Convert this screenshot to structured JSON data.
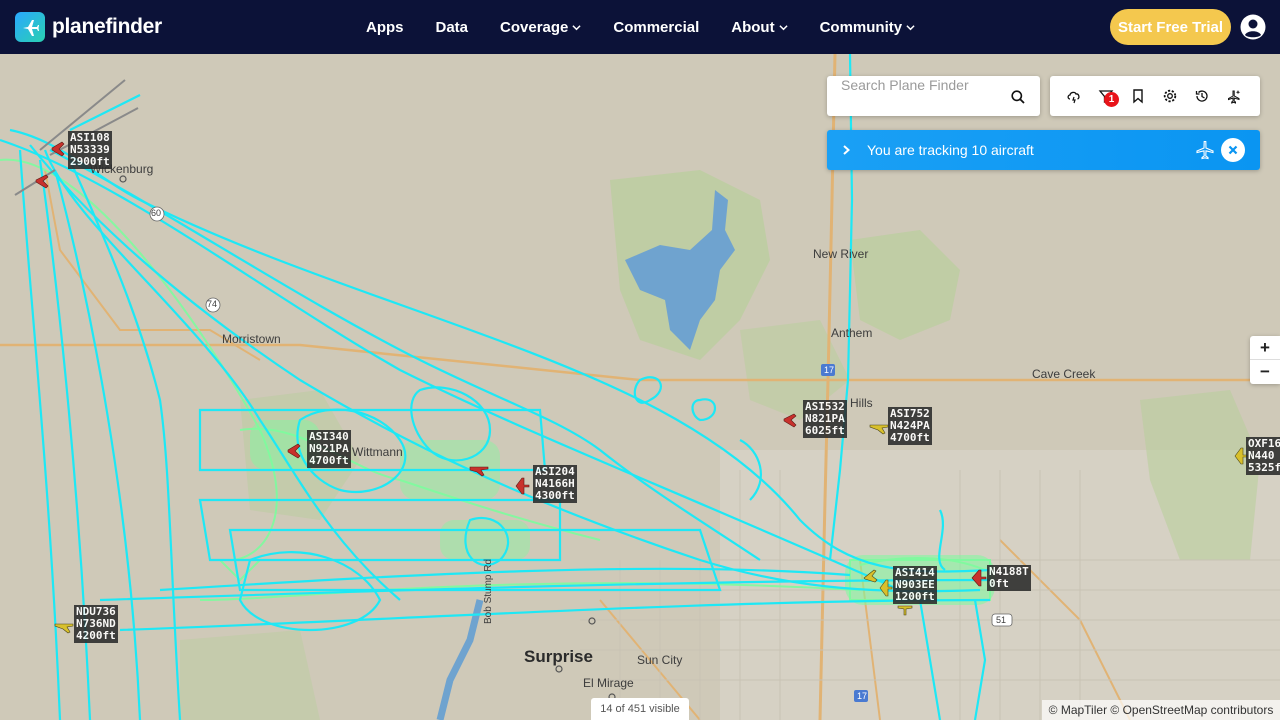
{
  "header": {
    "brand": "planefinder",
    "nav": [
      {
        "label": "Apps",
        "has_dropdown": false
      },
      {
        "label": "Data",
        "has_dropdown": false
      },
      {
        "label": "Coverage",
        "has_dropdown": true
      },
      {
        "label": "Commercial",
        "has_dropdown": false
      },
      {
        "label": "About",
        "has_dropdown": true
      },
      {
        "label": "Community",
        "has_dropdown": true
      }
    ],
    "cta": "Start Free Trial",
    "account_icon": "user-circle-icon"
  },
  "search": {
    "placeholder": "Search Plane Finder"
  },
  "toolbar": {
    "icons": [
      "weather-icon",
      "filter-icon",
      "bookmark-icon",
      "settings-icon",
      "history-icon",
      "flight-mode-icon"
    ],
    "filter_badge": "1"
  },
  "tracking": {
    "text": "You are tracking 10 aircraft"
  },
  "zoom": {
    "in": "+",
    "out": "−"
  },
  "map": {
    "places": {
      "wickenburg": "Wickenburg",
      "morristown": "Morristown",
      "wittmann": "Wittmann",
      "new_river": "New River",
      "anthem": "Anthem",
      "cave_creek": "Cave Creek",
      "hills": "Hills",
      "surprise": "Surprise",
      "sun_city": "Sun City",
      "el_mirage": "El Mirage",
      "bob_stump": "Bob Stump Rd",
      "hwy_17a": "17",
      "hwy_17b": "17",
      "hwy_51": "51",
      "hwy_74": "74",
      "hwy_60": "60"
    },
    "aircraft": [
      {
        "id": "ac-asi108",
        "line1": "ASI108",
        "line2": "N53339",
        "line3": "2900ft"
      },
      {
        "id": "ac-asi340",
        "line1": "ASI340",
        "line2": "N921PA",
        "line3": "4700ft"
      },
      {
        "id": "ac-asi204",
        "line1": "ASI204",
        "line2": "N4166H",
        "line3": "4300ft"
      },
      {
        "id": "ac-asi532",
        "line1": "ASI532",
        "line2": "N821PA",
        "line3": "6025ft"
      },
      {
        "id": "ac-asi752",
        "line1": "ASI752",
        "line2": "N424PA",
        "line3": "4700ft"
      },
      {
        "id": "ac-oxf",
        "line1": "OXF16",
        "line2": "N440",
        "line3": "5325f"
      },
      {
        "id": "ac-asi414",
        "line1": "ASI414",
        "line2": "N903EE",
        "line3": "1200ft"
      },
      {
        "id": "ac-n4188t",
        "line1": "N4188T",
        "line2": "0ft",
        "line3": ""
      },
      {
        "id": "ac-ndu736",
        "line1": "NDU736",
        "line2": "N736ND",
        "line3": "4200ft"
      }
    ],
    "colors": {
      "track_cyan": "#1ee8f5",
      "track_green": "#7dfc9e",
      "lake": "#6fa3cf",
      "park": "#b9ce9d",
      "plane_red": "#c8312c",
      "plane_yellow": "#d8c02c"
    }
  },
  "footer": {
    "visible_count": "14 of 451 visible",
    "attribution": "© MapTiler © OpenStreetMap contributors"
  }
}
